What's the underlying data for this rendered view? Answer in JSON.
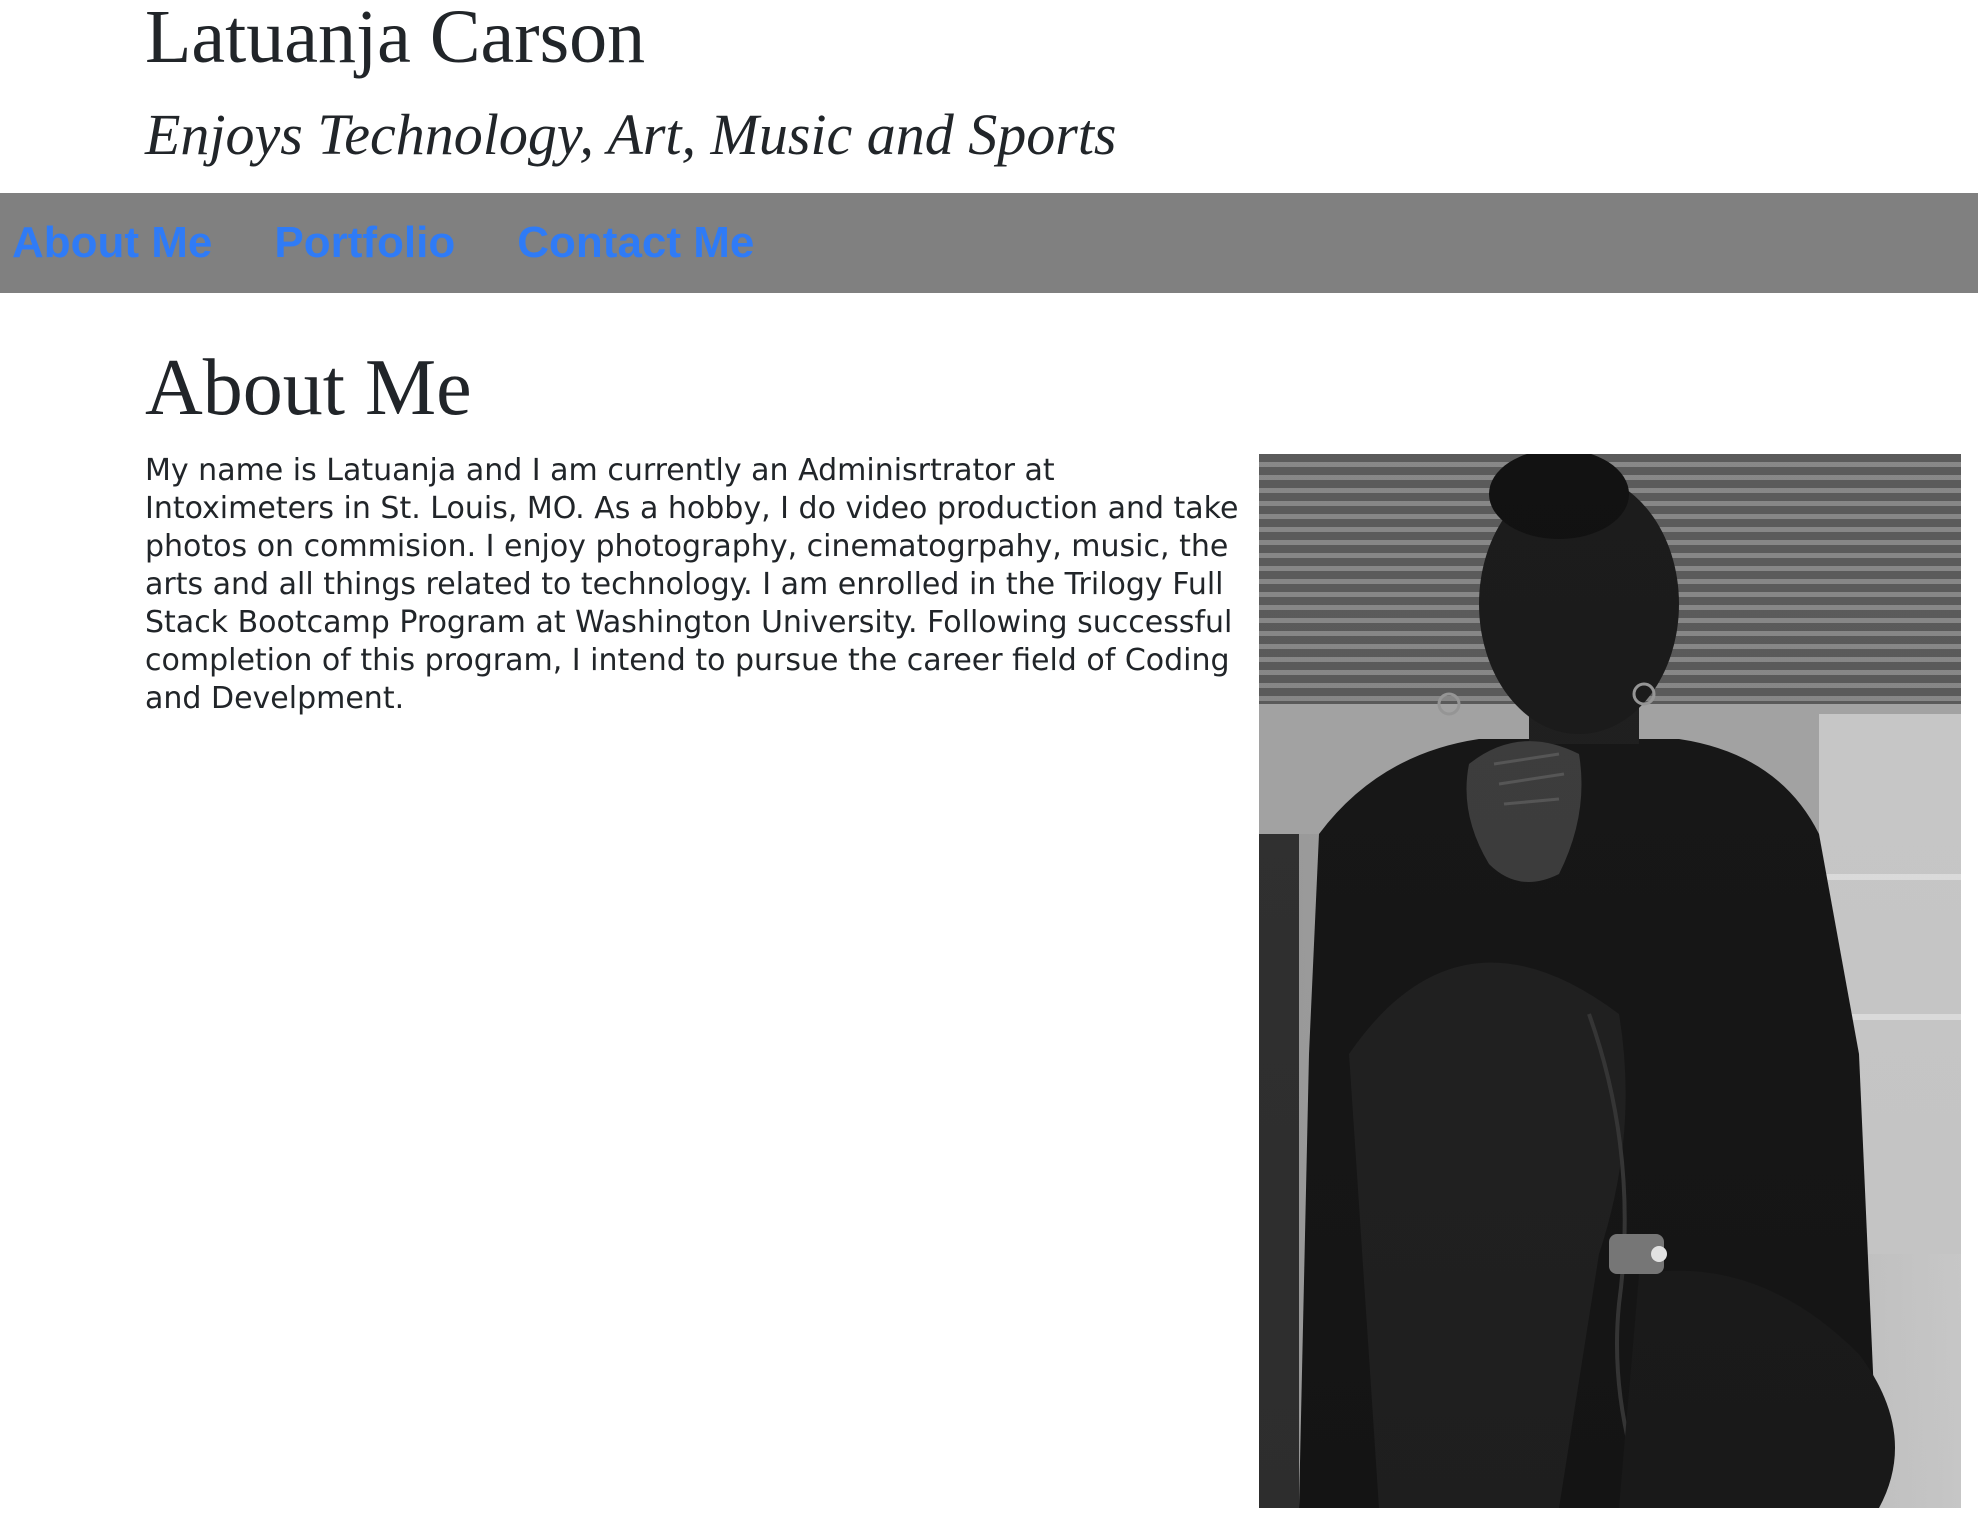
{
  "header": {
    "name": "Latuanja Carson",
    "tagline": "Enjoys Technology, Art, Music and Sports"
  },
  "nav": {
    "items": [
      {
        "label": "About Me"
      },
      {
        "label": "Portfolio"
      },
      {
        "label": "Contact Me"
      }
    ]
  },
  "about": {
    "heading": "About Me",
    "bio": "My name is Latuanja and I am currently an Adminisrtrator at Intoximeters in St. Louis, MO. As a hobby, I do video production and take photos on commision. I enjoy photography, cinematogrpahy, music, the arts and all things related to technology. I am enrolled in the Trilogy Full Stack Bootcamp Program at Washington University. Following successful completion of this program, I intend to pursue the career field of Coding and Develpment."
  },
  "colors": {
    "nav_background": "#808080",
    "nav_link": "#2f7bf6",
    "text": "#212529"
  }
}
